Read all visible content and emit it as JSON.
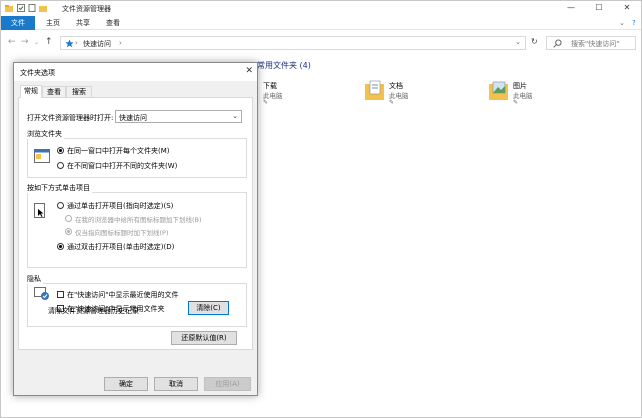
{
  "explorer": {
    "title": "文件资源管理器",
    "ribbon_tabs": [
      "文件",
      "主页",
      "共享",
      "查看"
    ],
    "address_path": "快速访问",
    "search_placeholder": "搜索\"快速访问\"",
    "group_header": "常用文件夹 (4)",
    "folders": [
      {
        "name": "下载",
        "sub": "此电脑"
      },
      {
        "name": "文档",
        "sub": "此电脑"
      },
      {
        "name": "图片",
        "sub": "此电脑"
      }
    ]
  },
  "dialog": {
    "title": "文件夹选项",
    "close_glyph": "✕",
    "tabs": [
      "常规",
      "查看",
      "搜索"
    ],
    "open_label": "打开文件资源管理器时打开:",
    "open_value": "快速访问",
    "browse_group": {
      "title": "浏览文件夹",
      "options": [
        "在同一窗口中打开每个文件夹(M)",
        "在不同窗口中打开不同的文件夹(W)"
      ]
    },
    "click_group": {
      "title": "按如下方式单击项目",
      "options": [
        "通过单击打开项目(指向时选定)(S)",
        "在我的浏览器中给所有图标标题加下划线(B)",
        "仅当指向图标标题时加下划线(P)",
        "通过双击打开项目(单击时选定)(D)"
      ]
    },
    "privacy_group": {
      "title": "隐私",
      "checks": [
        "在\"快速访问\"中显示最近使用的文件",
        "在\"快速访问\"中显示常用文件夹"
      ],
      "clear_label": "清除文件资源管理器历史记录",
      "clear_button": "清除(C)"
    },
    "restore_button": "还原默认值(R)",
    "ok_button": "确定",
    "cancel_button": "取消",
    "apply_button": "应用(A)"
  },
  "colors": {
    "accent": "#1979ca",
    "focus": "#0078d7"
  }
}
